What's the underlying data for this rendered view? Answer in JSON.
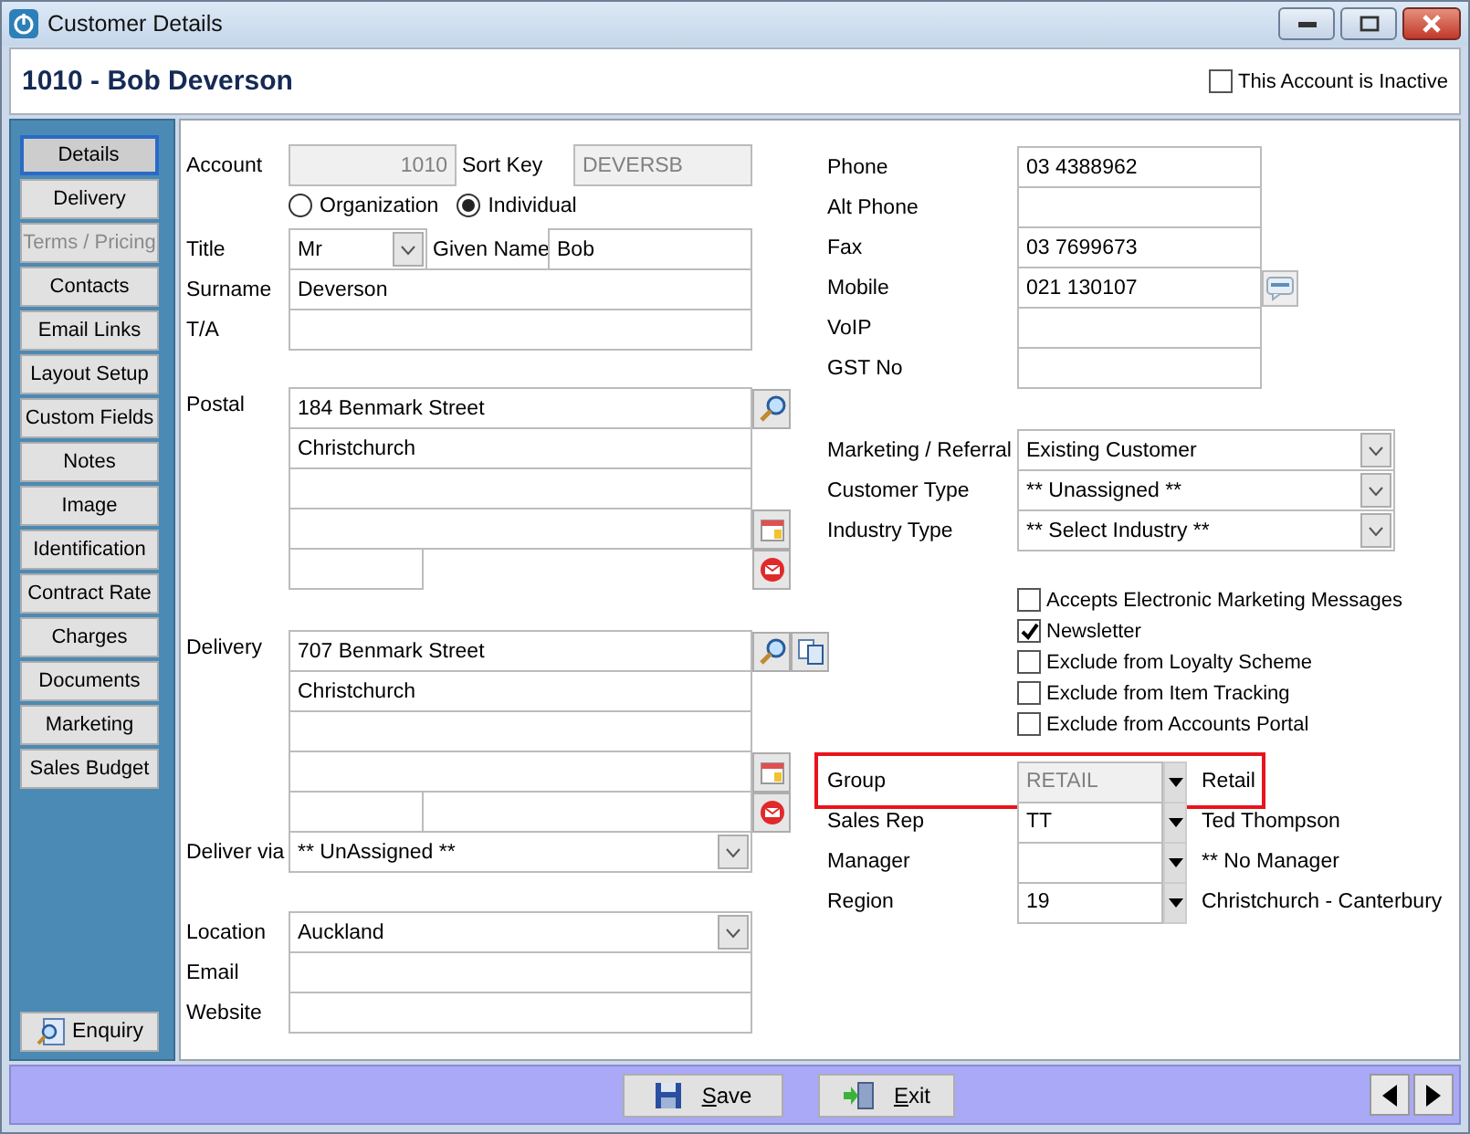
{
  "window": {
    "title": "Customer Details"
  },
  "header": {
    "title": "1010 - Bob Deverson",
    "inactive": {
      "label": "This Account is Inactive",
      "checked": false
    }
  },
  "sidebar": {
    "items": [
      {
        "label": "Details",
        "selected": true,
        "disabled": false
      },
      {
        "label": "Delivery",
        "selected": false,
        "disabled": false
      },
      {
        "label": "Terms / Pricing",
        "selected": false,
        "disabled": true
      },
      {
        "label": "Contacts",
        "selected": false,
        "disabled": false
      },
      {
        "label": "Email Links",
        "selected": false,
        "disabled": false
      },
      {
        "label": "Layout Setup",
        "selected": false,
        "disabled": false
      },
      {
        "label": "Custom Fields",
        "selected": false,
        "disabled": false
      },
      {
        "label": "Notes",
        "selected": false,
        "disabled": false
      },
      {
        "label": "Image",
        "selected": false,
        "disabled": false
      },
      {
        "label": "Identification",
        "selected": false,
        "disabled": false
      },
      {
        "label": "Contract Rate",
        "selected": false,
        "disabled": false
      },
      {
        "label": "Charges",
        "selected": false,
        "disabled": false
      },
      {
        "label": "Documents",
        "selected": false,
        "disabled": false
      },
      {
        "label": "Marketing",
        "selected": false,
        "disabled": false
      },
      {
        "label": "Sales Budget",
        "selected": false,
        "disabled": false
      }
    ],
    "enquiry": "Enquiry"
  },
  "account": {
    "label": "Account",
    "value": "1010"
  },
  "sort_key": {
    "label": "Sort Key",
    "value": "DEVERSB"
  },
  "entity_type": [
    {
      "label": "Organization",
      "selected": false
    },
    {
      "label": "Individual",
      "selected": true
    }
  ],
  "title_field": {
    "label": "Title",
    "value": "Mr"
  },
  "given_name": {
    "label": "Given Name",
    "value": "Bob"
  },
  "surname": {
    "label": "Surname",
    "value": "Deverson"
  },
  "trading_as": {
    "label": "T/A"
  },
  "postal": {
    "label": "Postal",
    "lines": [
      "184 Benmark Street",
      "Christchurch"
    ]
  },
  "delivery": {
    "label": "Delivery",
    "lines": [
      "707 Benmark Street",
      "Christchurch"
    ]
  },
  "deliver_via": {
    "label": "Deliver via",
    "value": "** UnAssigned **"
  },
  "location": {
    "label": "Location",
    "value": "Auckland"
  },
  "email": {
    "label": "Email"
  },
  "website": {
    "label": "Website"
  },
  "phones": [
    {
      "label": "Phone",
      "value": "03 4388962",
      "sms": false
    },
    {
      "label": "Alt Phone",
      "sms": false
    },
    {
      "label": "Fax",
      "value": "03 7699673",
      "sms": false
    },
    {
      "label": "Mobile",
      "value": "021 130107",
      "sms": true
    },
    {
      "label": "VoIP",
      "sms": false
    },
    {
      "label": "GST No",
      "sms": false
    }
  ],
  "classification": [
    {
      "label": "Marketing / Referral",
      "value": "Existing Customer"
    },
    {
      "label": "Customer Type",
      "value": "** Unassigned **"
    },
    {
      "label": "Industry Type",
      "value": "** Select Industry **"
    }
  ],
  "options": [
    {
      "label": "Accepts Electronic Marketing Messages",
      "checked": false
    },
    {
      "label": "Newsletter",
      "checked": true
    },
    {
      "label": "Exclude from Loyalty Scheme",
      "checked": false
    },
    {
      "label": "Exclude from Item Tracking",
      "checked": false
    },
    {
      "label": "Exclude from Accounts Portal",
      "checked": false
    }
  ],
  "assignments": [
    {
      "label": "Group",
      "code": "RETAIL",
      "name": "Retail",
      "disabled": true,
      "highlighted": true
    },
    {
      "label": "Sales Rep",
      "code": "TT",
      "name": "Ted Thompson",
      "disabled": false,
      "highlighted": false
    },
    {
      "label": "Manager",
      "name": "** No Manager",
      "disabled": false,
      "highlighted": false
    },
    {
      "label": "Region",
      "code": "19",
      "name": "Christchurch - Canterbury",
      "disabled": false,
      "highlighted": false
    }
  ],
  "footer": {
    "buttons": [
      {
        "label": "Save",
        "kind": "save"
      },
      {
        "label": "Exit",
        "kind": "exit"
      }
    ]
  }
}
